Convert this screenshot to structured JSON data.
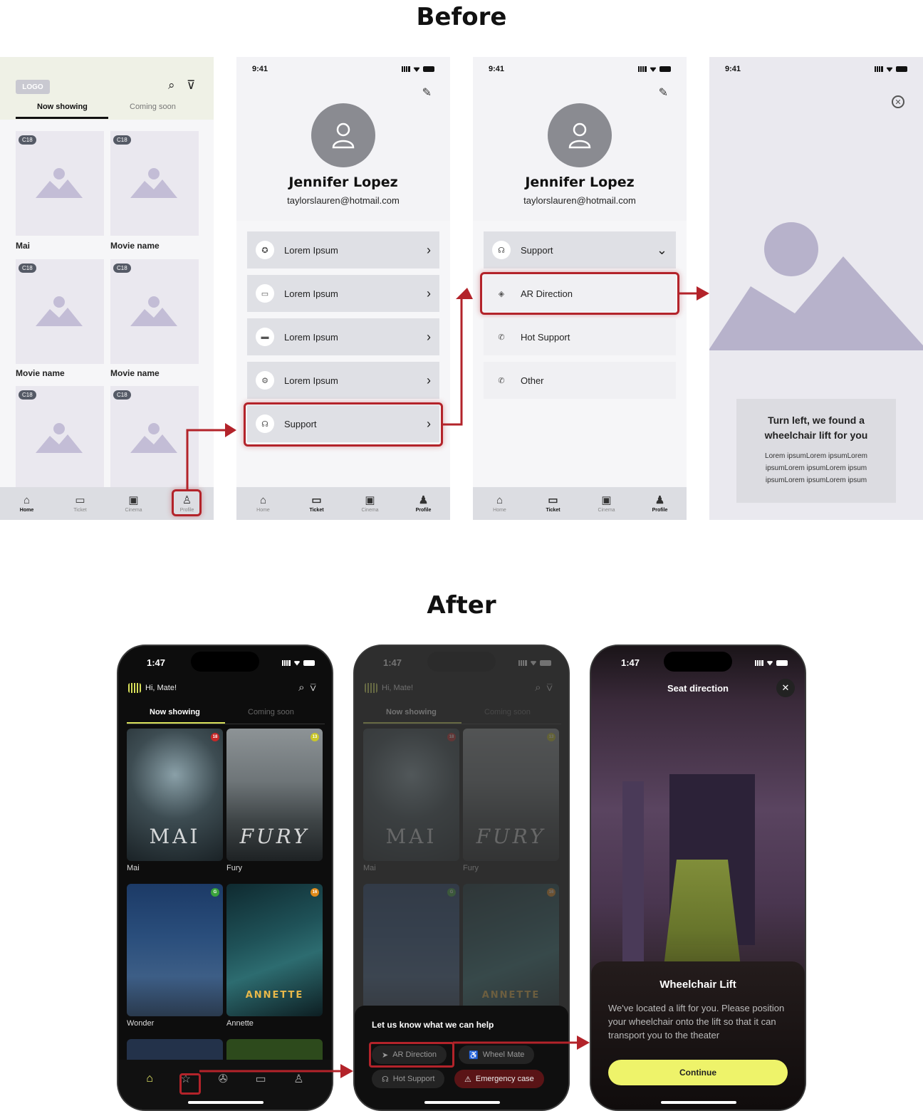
{
  "headings": {
    "before": "Before",
    "after": "After"
  },
  "wireframe_home": {
    "logo": "LOGO",
    "tabs": [
      "Now showing",
      "Coming soon"
    ],
    "badge": "C18",
    "movies": [
      "Mai",
      "Movie name",
      "Movie name",
      "Movie name"
    ],
    "nav": [
      "Home",
      "Ticket",
      "Cinema",
      "Profile"
    ]
  },
  "wireframe_profile": {
    "time": "9:41",
    "name": "Jennifer Lopez",
    "email": "taylorslauren@hotmail.com",
    "menu": [
      "Lorem Ipsum",
      "Lorem Ipsum",
      "Lorem Ipsum",
      "Lorem Ipsum",
      "Support"
    ],
    "nav": [
      "Home",
      "Ticket",
      "Cinema",
      "Profile"
    ]
  },
  "wireframe_support": {
    "time": "9:41",
    "name": "Jennifer Lopez",
    "email": "taylorslauren@hotmail.com",
    "header": "Support",
    "items": [
      "AR Direction",
      "Hot Support",
      "Other"
    ],
    "nav": [
      "Home",
      "Ticket",
      "Cinema",
      "Profile"
    ]
  },
  "wireframe_ar": {
    "time": "9:41",
    "title": "Turn left, we found a wheelchair lift for you",
    "body": "Lorem ipsumLorem ipsumLorem ipsumLorem ipsumLorem ipsum ipsumLorem ipsumLorem ipsum"
  },
  "app_home": {
    "time": "1:47",
    "greeting": "Hi, Mate!",
    "tabs": [
      "Now showing",
      "Coming soon"
    ],
    "movies": [
      {
        "name": "Mai",
        "badge": "18",
        "badge_color": "#c62828",
        "poster_title": "MAI"
      },
      {
        "name": "Fury",
        "badge": "13",
        "badge_color": "#c9c62a",
        "poster_title": "FURY"
      },
      {
        "name": "Wonder",
        "badge": "G",
        "badge_color": "#3aa33a",
        "poster_title": ""
      },
      {
        "name": "Annette",
        "badge": "16",
        "badge_color": "#e08a1a",
        "poster_title": "ANNETTE"
      }
    ]
  },
  "app_help": {
    "sheet_title": "Let us know what we can help",
    "chips": [
      "AR Direction",
      "Wheel Mate",
      "Hot Support",
      "Emergency case"
    ]
  },
  "app_ar": {
    "time": "1:47",
    "title": "Seat direction",
    "card_title": "Wheelchair Lift",
    "card_body": "We've located a lift for you. Please position your wheelchair onto the lift so that it can transport you to the theater",
    "button": "Continue"
  },
  "colors": {
    "accent": "#eef36a",
    "highlight": "#b3232a"
  }
}
